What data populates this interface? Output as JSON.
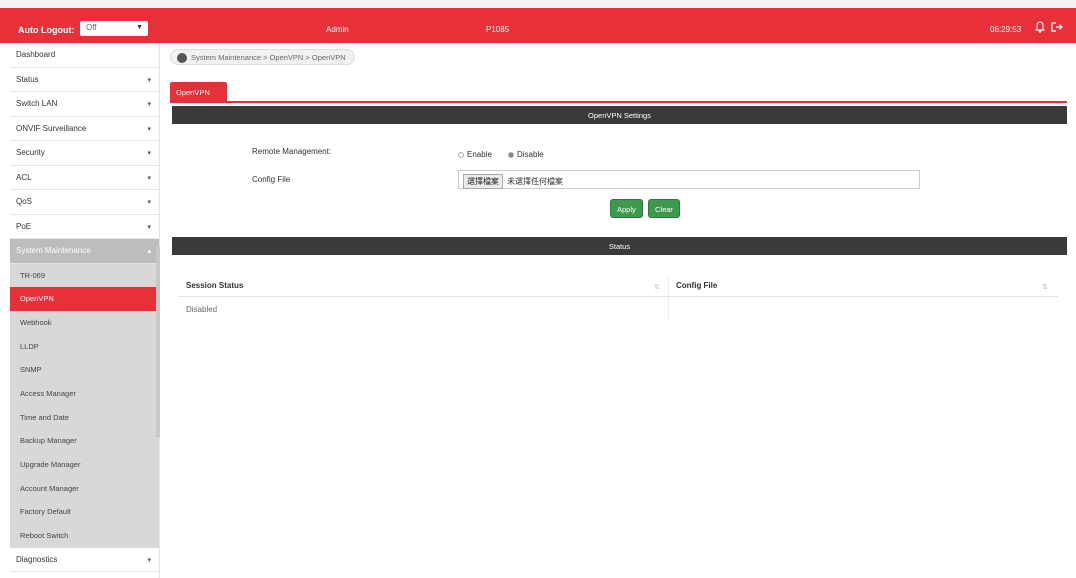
{
  "header": {
    "auto_logout_label": "Auto Logout:",
    "auto_logout_value": "Off",
    "user": "Admin",
    "model": "P1085",
    "time": "06:29:53"
  },
  "sidebar": {
    "items": [
      {
        "label": "Dashboard"
      },
      {
        "label": "Status"
      },
      {
        "label": "Switch LAN"
      },
      {
        "label": "ONVIF Surveillance"
      },
      {
        "label": "Security"
      },
      {
        "label": "ACL"
      },
      {
        "label": "QoS"
      },
      {
        "label": "PoE"
      }
    ],
    "group_label": "System Maintenance",
    "sub_items": [
      {
        "label": "TR-069"
      },
      {
        "label": "OpenVPN"
      },
      {
        "label": "Webhook"
      },
      {
        "label": "LLDP"
      },
      {
        "label": "SNMP"
      },
      {
        "label": "Access Manager"
      },
      {
        "label": "Time and Date"
      },
      {
        "label": "Backup Manager"
      },
      {
        "label": "Upgrade Manager"
      },
      {
        "label": "Account Manager"
      },
      {
        "label": "Factory Default"
      },
      {
        "label": "Reboot Switch"
      }
    ],
    "bottom_item": "Diagnostics"
  },
  "breadcrumb": "System Maintenance > OpenVPN > OpenVPN",
  "tab": "OpenVPN",
  "settings": {
    "header": "OpenVPN Settings",
    "remote_label": "Remote Management:",
    "enable": "Enable",
    "disable": "Disable",
    "config_label": "Config File",
    "file_button": "選擇檔案",
    "file_status": "未選擇任何檔案",
    "apply": "Apply",
    "clear": "Clear"
  },
  "status": {
    "header": "Status",
    "col_session": "Session Status",
    "col_config": "Config File",
    "row_session": "Disabled",
    "row_config": ""
  },
  "colors": {
    "accent": "#e8303a",
    "header_bar": "#3a3a3a",
    "button_green": "#3c9a4c"
  }
}
